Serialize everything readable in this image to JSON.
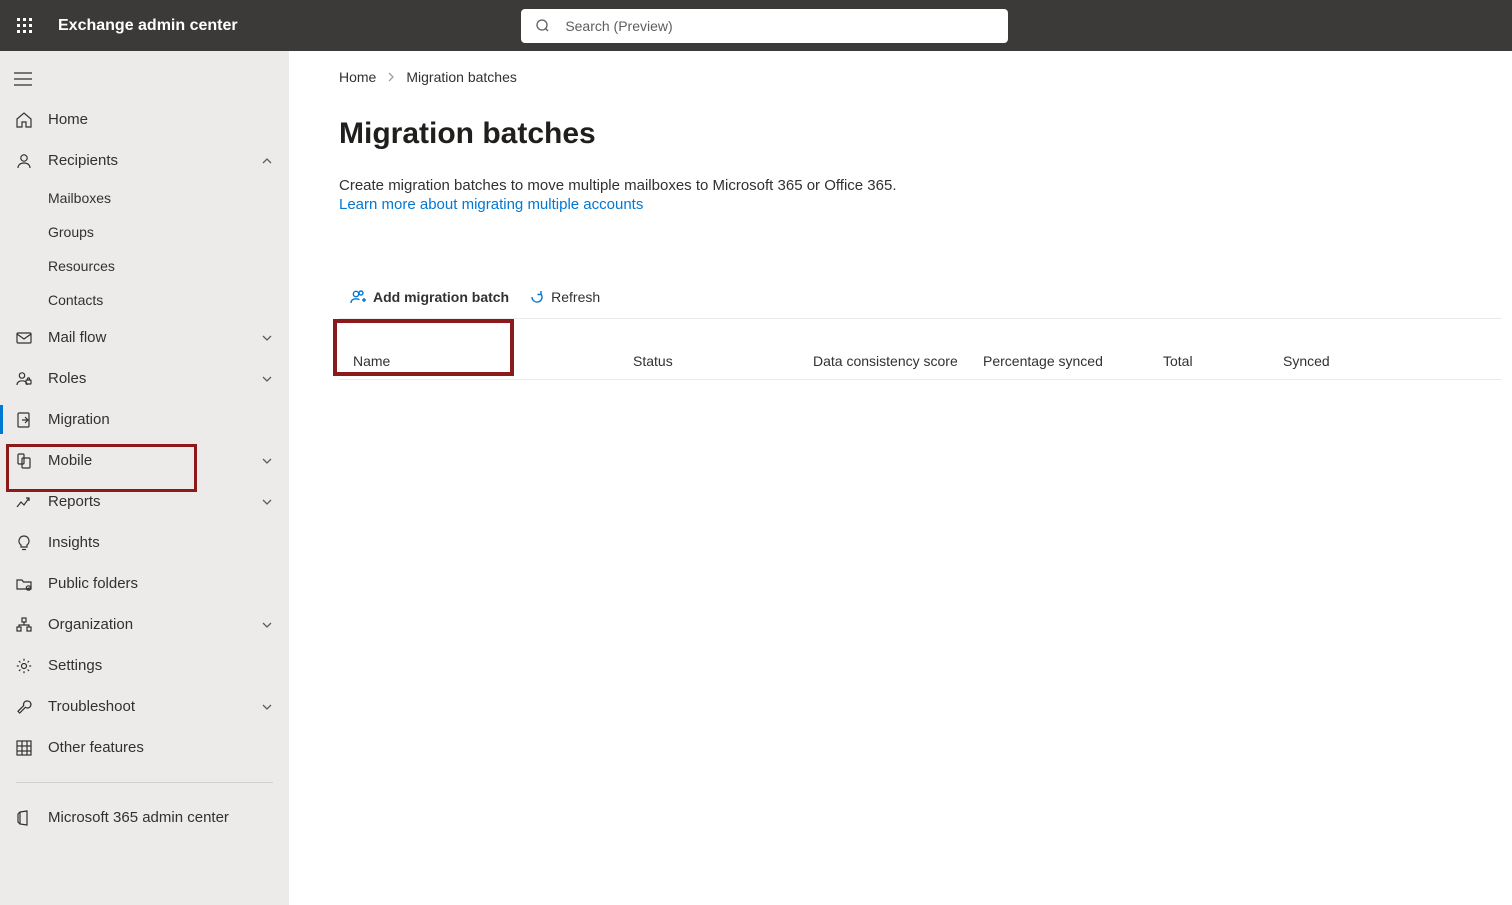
{
  "header": {
    "app_title": "Exchange admin center",
    "search_placeholder": "Search (Preview)"
  },
  "sidebar": {
    "items": [
      {
        "icon": "home-icon",
        "label": "Home"
      },
      {
        "icon": "person-icon",
        "label": "Recipients",
        "expandable": true,
        "expanded": true
      },
      {
        "sub": true,
        "label": "Mailboxes"
      },
      {
        "sub": true,
        "label": "Groups"
      },
      {
        "sub": true,
        "label": "Resources"
      },
      {
        "sub": true,
        "label": "Contacts"
      },
      {
        "icon": "mail-icon",
        "label": "Mail flow",
        "expandable": true
      },
      {
        "icon": "roles-icon",
        "label": "Roles",
        "expandable": true
      },
      {
        "icon": "migration-icon",
        "label": "Migration",
        "active": true
      },
      {
        "icon": "mobile-icon",
        "label": "Mobile",
        "expandable": true
      },
      {
        "icon": "reports-icon",
        "label": "Reports",
        "expandable": true
      },
      {
        "icon": "insights-icon",
        "label": "Insights"
      },
      {
        "icon": "folders-icon",
        "label": "Public folders"
      },
      {
        "icon": "org-icon",
        "label": "Organization",
        "expandable": true
      },
      {
        "icon": "settings-icon",
        "label": "Settings"
      },
      {
        "icon": "troubleshoot-icon",
        "label": "Troubleshoot",
        "expandable": true
      },
      {
        "icon": "grid-icon",
        "label": "Other features"
      }
    ],
    "footer": {
      "icon": "m365-icon",
      "label": "Microsoft 365 admin center"
    }
  },
  "breadcrumb": {
    "home": "Home",
    "current": "Migration batches"
  },
  "page": {
    "title": "Migration batches",
    "description": "Create migration batches to move multiple mailboxes to Microsoft 365 or Office 365.",
    "learn_more": "Learn more about migrating multiple accounts"
  },
  "commands": {
    "add": "Add migration batch",
    "refresh": "Refresh"
  },
  "table": {
    "columns": [
      "Name",
      "Status",
      "Data consistency score",
      "Percentage synced",
      "Total",
      "Synced"
    ],
    "rows": []
  }
}
